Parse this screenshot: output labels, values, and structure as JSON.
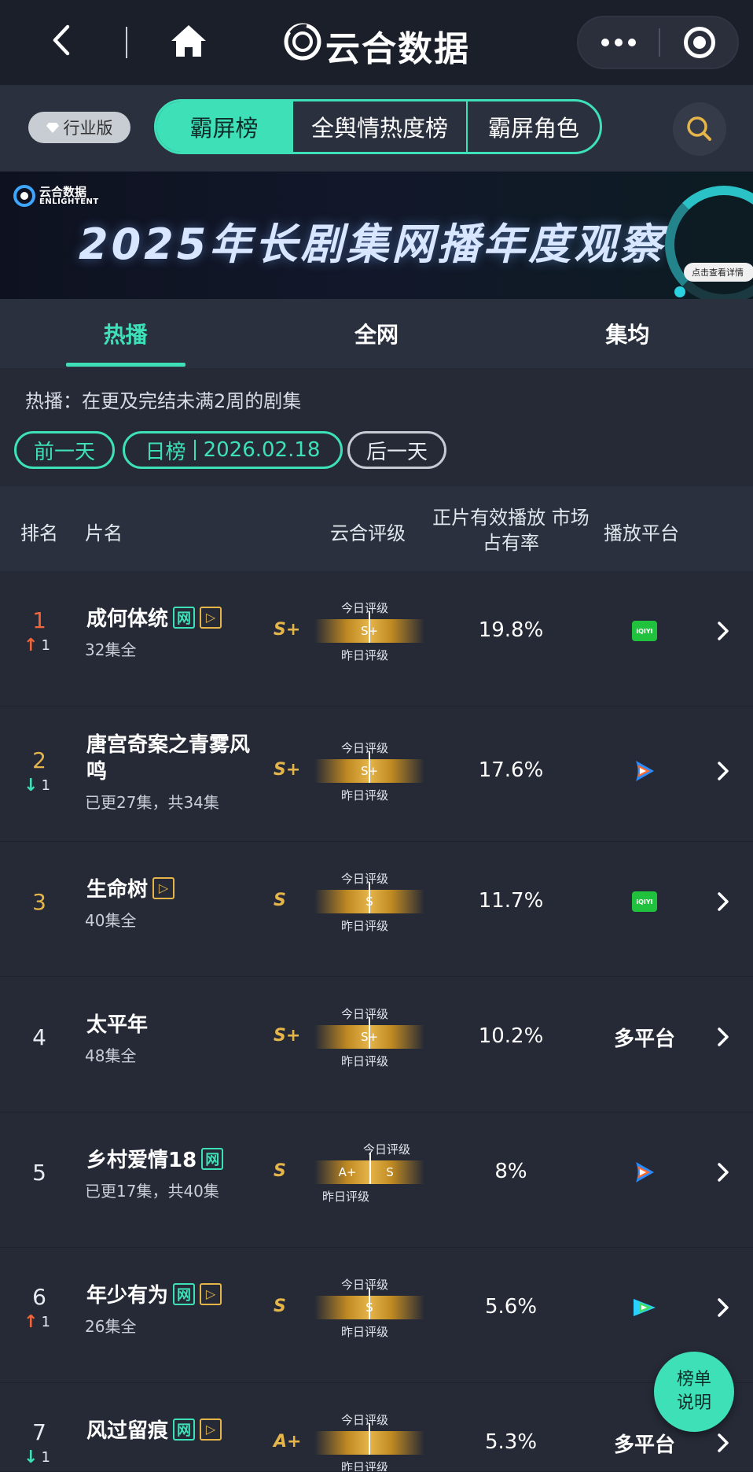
{
  "topbar": {
    "app_title": "云合数据"
  },
  "subnav": {
    "industry_label": "行业版",
    "segments": [
      "霸屏榜",
      "全舆情热度榜",
      "霸屏角色"
    ]
  },
  "banner": {
    "logo_cn": "云合数据",
    "logo_en": "ENLIGHTENT",
    "title": "2025年长剧集网播年度观察",
    "cta": "点击查看详情"
  },
  "tabs": [
    "热播",
    "全网",
    "集均"
  ],
  "filter": {
    "description": "热播：在更及完结未满2周的剧集",
    "prev_day": "前一天",
    "chart_type": "日榜",
    "date": "2026.02.18",
    "next_day": "后一天"
  },
  "table_header": {
    "rank": "排名",
    "name": "片名",
    "grade": "云合评级",
    "share": "正片有效播放\n市场占有率",
    "platform": "播放平台"
  },
  "gauge_labels": {
    "today": "今日评级",
    "yesterday": "昨日评级"
  },
  "tags": {
    "net": "网",
    "vip": "▷"
  },
  "rows": [
    {
      "rank": "1",
      "trend_dir": "up",
      "trend_value": "1",
      "title": "成何体统",
      "net": true,
      "vip": true,
      "episodes": "32集全",
      "grade": "S+",
      "gauge_value": "S+",
      "share": "19.8%",
      "platform": "iqiyi",
      "platform_text": "iQIYI"
    },
    {
      "rank": "2",
      "trend_dir": "down",
      "trend_value": "1",
      "title": "唐宫奇案之青雾风鸣",
      "net": false,
      "vip": false,
      "episodes": "已更27集，共34集",
      "grade": "S+",
      "gauge_value": "S+",
      "share": "17.6%",
      "platform": "tencent",
      "platform_text": ""
    },
    {
      "rank": "3",
      "trend_dir": "",
      "trend_value": "",
      "title": "生命树",
      "net": false,
      "vip": true,
      "episodes": "40集全",
      "grade": "S",
      "gauge_value": "S",
      "share": "11.7%",
      "platform": "iqiyi",
      "platform_text": "iQIYI"
    },
    {
      "rank": "4",
      "trend_dir": "",
      "trend_value": "",
      "title": "太平年",
      "net": false,
      "vip": false,
      "episodes": "48集全",
      "grade": "S+",
      "gauge_value": "S+",
      "share": "10.2%",
      "platform": "multi",
      "platform_text": "多平台"
    },
    {
      "rank": "5",
      "trend_dir": "",
      "trend_value": "",
      "title": "乡村爱情18",
      "net": true,
      "vip": false,
      "episodes": "已更17集，共40集",
      "grade": "S",
      "gauge_value": "S",
      "gauge_prev": "A+",
      "share": "8%",
      "platform": "tencent",
      "platform_text": ""
    },
    {
      "rank": "6",
      "trend_dir": "up",
      "trend_value": "1",
      "title": "年少有为",
      "net": true,
      "vip": true,
      "episodes": "26集全",
      "grade": "S",
      "gauge_value": "S",
      "share": "5.6%",
      "platform": "youku",
      "platform_text": ""
    },
    {
      "rank": "7",
      "trend_dir": "down",
      "trend_value": "1",
      "title": "风过留痕",
      "net": true,
      "vip": true,
      "episodes": "",
      "grade": "A+",
      "gauge_value": "",
      "share": "5.3%",
      "platform": "multi",
      "platform_text": "多平台"
    }
  ],
  "float_button": {
    "line1": "榜单",
    "line2": "说明"
  },
  "colors": {
    "accent": "#3ee0b8",
    "gold": "#e5b54a",
    "up": "#f0663a",
    "down": "#3ee0b8"
  }
}
